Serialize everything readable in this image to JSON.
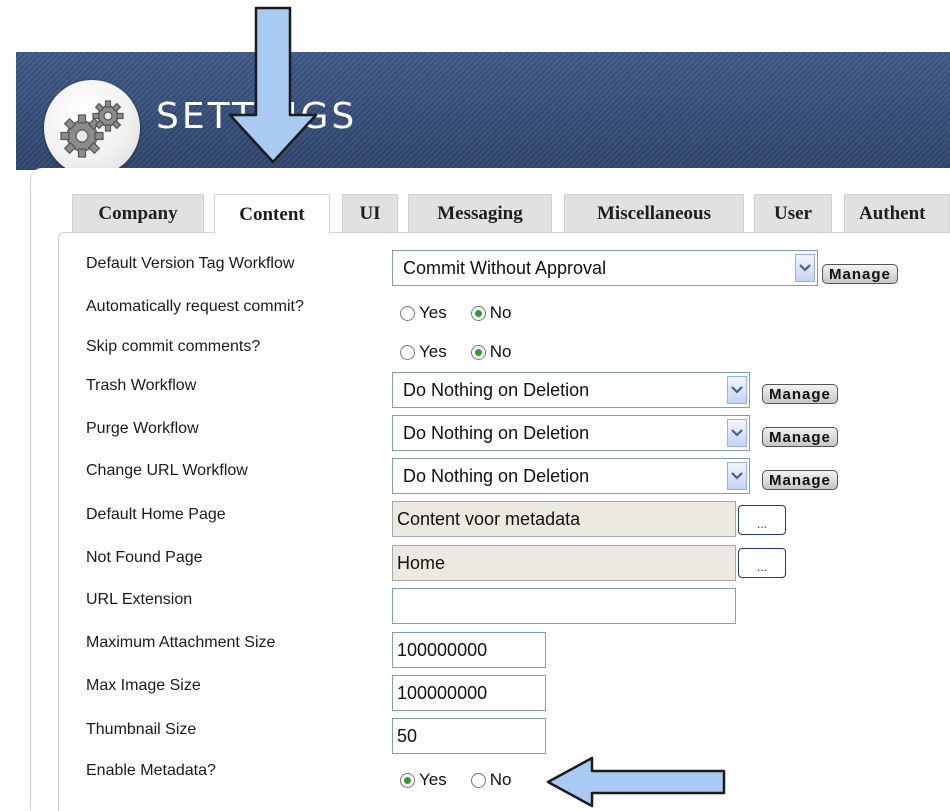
{
  "header": {
    "title": "SETTINGS",
    "logo_icon": "gears-icon"
  },
  "tabs": [
    {
      "label": "Company",
      "active": false
    },
    {
      "label": "Content",
      "active": true
    },
    {
      "label": "UI",
      "active": false
    },
    {
      "label": "Messaging",
      "active": false
    },
    {
      "label": "Miscellaneous",
      "active": false
    },
    {
      "label": "User",
      "active": false
    },
    {
      "label": "Authent",
      "active": false
    }
  ],
  "form": {
    "default_version_tag_workflow": {
      "label": "Default Version Tag Workflow",
      "value": "Commit Without Approval",
      "manage": "Manage"
    },
    "auto_request_commit": {
      "label": "Automatically request commit?",
      "yes": "Yes",
      "no": "No",
      "selected": "No"
    },
    "skip_commit_comments": {
      "label": "Skip commit comments?",
      "yes": "Yes",
      "no": "No",
      "selected": "No"
    },
    "trash_workflow": {
      "label": "Trash Workflow",
      "value": "Do Nothing on Deletion",
      "manage": "Manage"
    },
    "purge_workflow": {
      "label": "Purge Workflow",
      "value": "Do Nothing on Deletion",
      "manage": "Manage"
    },
    "change_url_workflow": {
      "label": "Change URL Workflow",
      "value": "Do Nothing on Deletion",
      "manage": "Manage"
    },
    "default_home_page": {
      "label": "Default Home Page",
      "value": "Content voor metadata",
      "browse": "..."
    },
    "not_found_page": {
      "label": "Not Found Page",
      "value": "Home",
      "browse": "..."
    },
    "url_extension": {
      "label": "URL Extension",
      "value": ""
    },
    "max_attachment_size": {
      "label": "Maximum Attachment Size",
      "value": "100000000"
    },
    "max_image_size": {
      "label": "Max Image Size",
      "value": "100000000"
    },
    "thumbnail_size": {
      "label": "Thumbnail Size",
      "value": "50"
    },
    "enable_metadata": {
      "label": "Enable Metadata?",
      "yes": "Yes",
      "no": "No",
      "selected": "Yes"
    }
  },
  "annotations": {
    "arrow_color": "#a9cbf3",
    "arrow_outline": "#1b1b1b"
  },
  "colors": {
    "banner": "#3a537f",
    "radio_selected": "#2d9b2d"
  }
}
